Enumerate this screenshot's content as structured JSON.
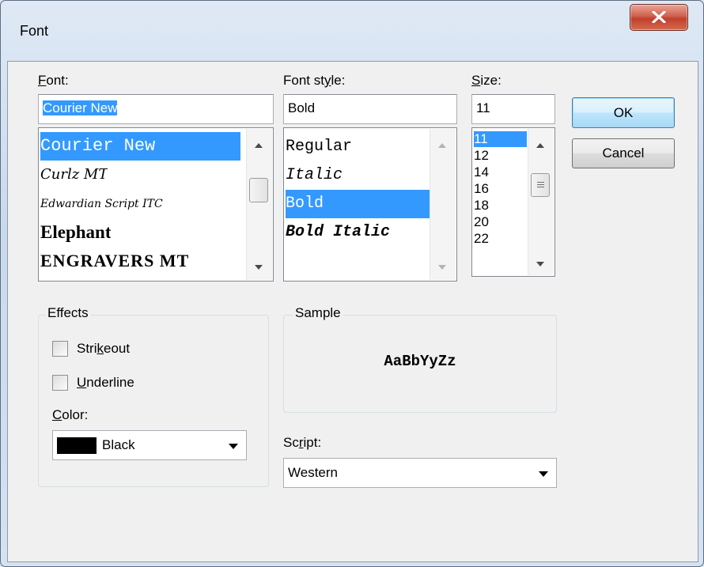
{
  "window": {
    "title": "Font"
  },
  "font": {
    "label_pre": "",
    "label_acc": "F",
    "label_post": "ont:",
    "value": "Courier New",
    "items": [
      "Courier New",
      "Curlz MT",
      "Edwardian Script ITC",
      "Elephant",
      "ENGRAVERS MT"
    ]
  },
  "style": {
    "label_pre": "Font st",
    "label_acc": "y",
    "label_post": "le:",
    "value": "Bold",
    "items": [
      "Regular",
      "Italic",
      "Bold",
      "Bold Italic"
    ]
  },
  "size": {
    "label_pre": "",
    "label_acc": "S",
    "label_post": "ize:",
    "value": "11",
    "items": [
      "11",
      "12",
      "14",
      "16",
      "18",
      "20",
      "22"
    ]
  },
  "buttons": {
    "ok": "OK",
    "cancel": "Cancel"
  },
  "effects": {
    "title": "Effects",
    "strikeout_pre": "Stri",
    "strikeout_acc": "k",
    "strikeout_post": "eout",
    "underline_pre": "",
    "underline_acc": "U",
    "underline_post": "nderline",
    "color_pre": "",
    "color_acc": "C",
    "color_post": "olor:",
    "color_value": "Black",
    "color_swatch": "#000000"
  },
  "sample": {
    "title": "Sample",
    "text": "AaBbYyZz"
  },
  "script": {
    "label_pre": "Sc",
    "label_acc": "r",
    "label_post": "ipt:",
    "value": "Western"
  },
  "colors": {
    "selection": "#3399ff",
    "dialog_bg": "#f0f0f0"
  }
}
